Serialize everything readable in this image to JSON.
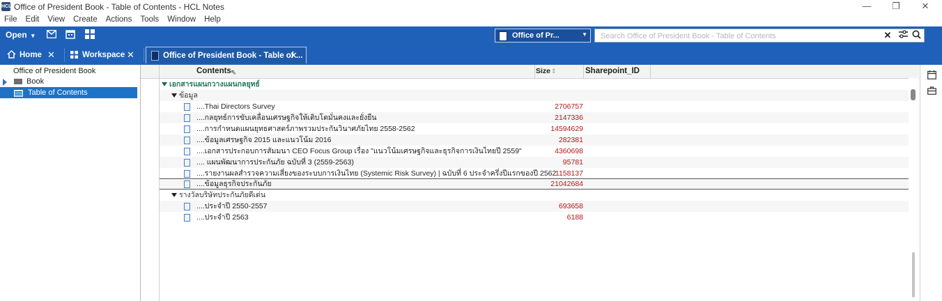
{
  "window": {
    "title": "Office of President Book - Table of Contents - HCL Notes",
    "app_icon_text": "HCL",
    "controls": [
      "—",
      "❐",
      "✕"
    ]
  },
  "menu": [
    "File",
    "Edit",
    "View",
    "Create",
    "Actions",
    "Tools",
    "Window",
    "Help"
  ],
  "toolbar": {
    "open_label": "Open",
    "open_caret": "▾",
    "icons": [
      "mail-icon",
      "calendar-icon",
      "apps-grid-icon"
    ],
    "database_selector": "Office of Pr...",
    "search_placeholder": "Search Office of President Book - Table of Contents",
    "search_clear": "✕",
    "search_options": "⚟",
    "search_go": "⌕"
  },
  "tabs": [
    {
      "label": "Home",
      "icon": "home-icon",
      "close": "✕",
      "active": false
    },
    {
      "label": "Workspace",
      "icon": "grid-icon",
      "close": "✕",
      "active": false
    },
    {
      "label": "Office of President Book - Table of ...",
      "icon": "database-icon",
      "close": "✕",
      "active": true
    }
  ],
  "nav": {
    "title": "Office of President Book",
    "items": [
      {
        "label": "Book",
        "icon": "folder-icon",
        "expandable": true,
        "selected": false
      },
      {
        "label": "Table of Contents",
        "icon": "view-icon",
        "expandable": false,
        "selected": true
      }
    ]
  },
  "view": {
    "columns": [
      "Contents",
      "Size",
      "Sharepoint_ID"
    ],
    "rows": [
      {
        "kind": "cat1",
        "text": "เอกสารแผนกวางแผนกลยุทธ์",
        "size": ""
      },
      {
        "kind": "cat2",
        "text": "ข้อมูล",
        "size": ""
      },
      {
        "kind": "doc",
        "text": "....Thai Directors Survey",
        "size": "2706757"
      },
      {
        "kind": "doc",
        "text": "....กลยุทธ์การขับเคลื่อนเศรษฐกิจให้เติบโตมั่นคงและยั่งยืน",
        "size": "2147336"
      },
      {
        "kind": "doc",
        "text": "....การกำหนดแผนยุทธศาสตร์ภาพรวมประกันวินาศภัยไทย 2558-2562",
        "size": "14594629"
      },
      {
        "kind": "doc",
        "text": "....ข้อมูลเศรษฐกิจ 2015 และแนวโน้ม 2016",
        "size": "282381"
      },
      {
        "kind": "doc",
        "text": "....เอกสารประกอบการสัมมนา CEO Focus Group เรื่อง \"แนวโน้มเศรษฐกิจและธุรกิจการเงินไทยปี 2559\"",
        "size": "4360698"
      },
      {
        "kind": "doc",
        "text": ".... แผนพัฒนาการประกันภัย ฉบับที่ 3 (2559-2563)",
        "size": "95781"
      },
      {
        "kind": "doc",
        "text": "....รายงานผลสำรวจความเสี่ยงของระบบการเงินไทย (Systemic Risk Survey) | ฉบับที่ 6 ประจำครึ่งปีแรกของปี 2562",
        "size": "1158137"
      },
      {
        "kind": "doc",
        "text": "....ข้อมูลธุรกิจประกันภัย",
        "size": "21042684",
        "current": true
      },
      {
        "kind": "cat2",
        "text": "รางวัลบริษัทประกันภัยดีเด่น",
        "size": ""
      },
      {
        "kind": "doc",
        "text": "....ประจำปี 2550-2557",
        "size": "693658"
      },
      {
        "kind": "doc",
        "text": "....ประจำปี 2563",
        "size": "6188"
      }
    ]
  },
  "right_pane_icons": [
    "calendar-icon",
    "briefcase-icon"
  ]
}
